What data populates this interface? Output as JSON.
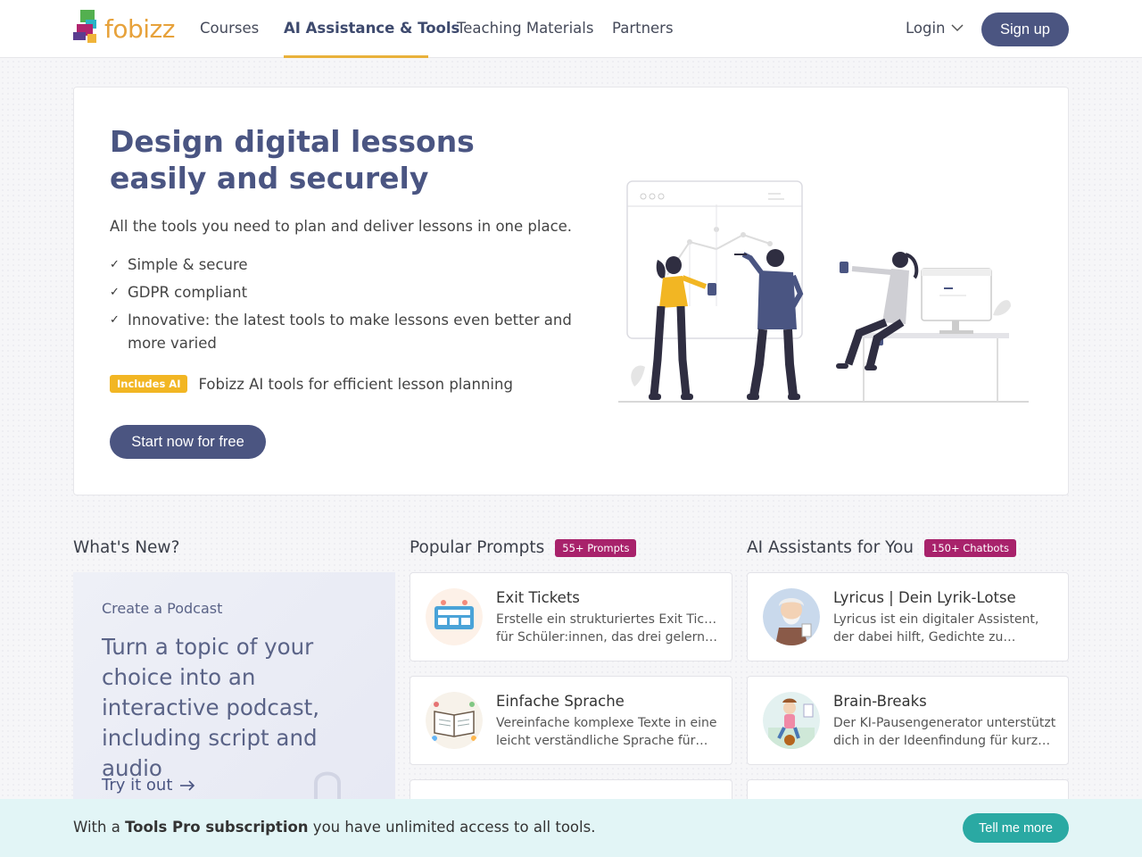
{
  "header": {
    "logo_text": "fobizz",
    "nav": [
      "Courses",
      "AI Assistance & Tools",
      "Teaching Materials",
      "Partners"
    ],
    "active_nav": "AI Assistance & Tools",
    "login": "Login",
    "signup": "Sign up"
  },
  "hero": {
    "title": "Design digital lessons easily and securely",
    "subtitle": "All the tools you need to plan and deliver lessons in one place.",
    "checks": [
      "Simple & secure",
      "GDPR compliant",
      "Innovative: the latest tools to make lessons even better and more varied"
    ],
    "ai_badge": "Includes AI",
    "ai_text": "Fobizz AI tools for efficient lesson planning",
    "cta": "Start now for free"
  },
  "whats_new": {
    "title": "What's New?",
    "kicker": "Create a Podcast",
    "headline": "Turn a topic of your choice into an interactive podcast, including script and audio",
    "link": "Try it out"
  },
  "prompts": {
    "title": "Popular Prompts",
    "badge": "55+ Prompts",
    "items": [
      {
        "title": "Exit Tickets",
        "desc": [
          "Erstelle ein strukturiertes Exit Ticket",
          "für Schüler:innen, das drei gelernt…"
        ]
      },
      {
        "title": "Einfache Sprache",
        "desc": [
          "Vereinfache komplexe Texte in eine",
          "leicht verständliche Sprache für…"
        ]
      }
    ]
  },
  "assistants": {
    "title": "AI Assistants for You",
    "badge": "150+ Chatbots",
    "items": [
      {
        "title": "Lyricus | Dein Lyrik-Lotse",
        "desc": [
          "Lyricus ist ein digitaler Assistent,",
          "der dabei hilft, Gedichte zu…"
        ]
      },
      {
        "title": "Brain-Breaks",
        "desc": [
          "Der KI-Pausengenerator unterstützt",
          "dich in der Ideenfindung für kurze…"
        ]
      }
    ]
  },
  "banner": {
    "prefix": "With a ",
    "bold": "Tools Pro subscription",
    "suffix": " you have unlimited access to all tools.",
    "button": "Tell me more"
  },
  "colors": {
    "primary": "#4b5581",
    "accent": "#e9b13b",
    "badge_magenta": "#a8226b",
    "teal": "#2aa9a3"
  }
}
